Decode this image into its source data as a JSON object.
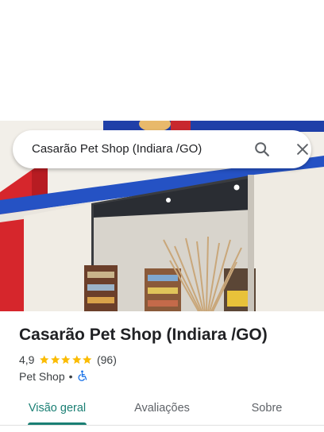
{
  "search": {
    "query": "Casarão Pet Shop (Indiara /GO)",
    "search_icon": "search-icon",
    "close_icon": "close-icon"
  },
  "place": {
    "title": "Casarão Pet Shop (Indiara /GO)",
    "rating": "4,9",
    "stars": 5,
    "review_count": "(96)",
    "category": "Pet Shop",
    "separator": "•",
    "accessibility_icon": "wheelchair-accessible-icon"
  },
  "tabs": [
    {
      "label": "Visão geral",
      "active": true
    },
    {
      "label": "Avaliações",
      "active": false
    },
    {
      "label": "Sobre",
      "active": false
    }
  ],
  "colors": {
    "accent": "#1a7f74",
    "star": "#fbbc04",
    "accessibility": "#1a73e8"
  }
}
